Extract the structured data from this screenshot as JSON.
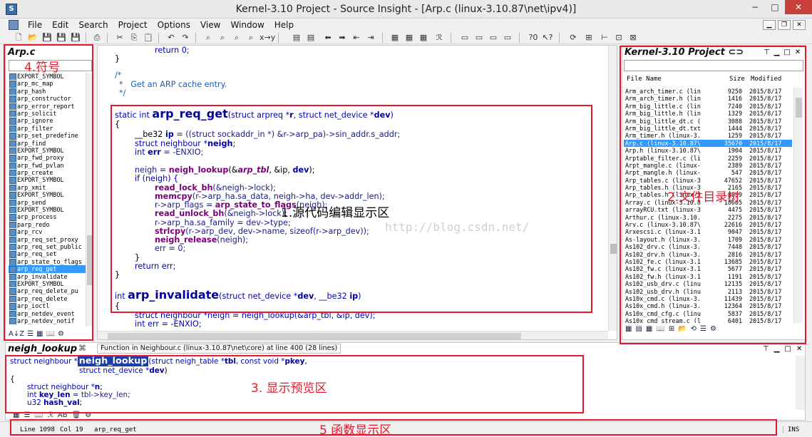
{
  "window": {
    "title": "Kernel-3.10 Project - Source Insight - [Arp.c (linux-3.10.87\\net\\ipv4)]",
    "min": "−",
    "max": "□",
    "close": "✕"
  },
  "menu": [
    "File",
    "Edit",
    "Search",
    "Project",
    "Options",
    "View",
    "Window",
    "Help"
  ],
  "symbols_panel": {
    "title": "Arp.c",
    "label": "4.符号",
    "items": [
      "EXPORT_SYMBOL",
      "arp_mc_map",
      "arp_hash",
      "arp_constructor",
      "arp_error_report",
      "arp_solicit",
      "arp_ignore",
      "arp_filter",
      "arp_set_predefine",
      "arp_find",
      "EXPORT_SYMBOL",
      "arp_fwd_proxy",
      "arp_fwd_pvlan",
      "arp_create",
      "EXPORT_SYMBOL",
      "arp_xmit",
      "EXPORT_SYMBOL",
      "arp_send",
      "EXPORT_SYMBOL",
      "arp_process",
      "parp_redo",
      "arp_rcv",
      "arp_req_set_proxy",
      "arp_req_set_public",
      "arp_req_set",
      "arp_state_to_flags",
      "arp_req_get",
      "arp_invalidate",
      "EXPORT_SYMBOL",
      "arp_req_delete_pu",
      "arp_req_delete",
      "arp_ioctl",
      "arp_netdev_event",
      "arp_netdev_notif"
    ],
    "selected_index": 26
  },
  "editor": {
    "label": "1.源代码编辑显示区",
    "watermark": "http://blog.csdn.net/",
    "lines": {
      "l1": "return 0;",
      "l2": "}",
      "l3": "/*",
      "l4": "*   Get an ARP cache entry.",
      "l5": "*/",
      "sig_kw1": "static int ",
      "sig_name": "arp_req_get",
      "sig_rest1": "(struct arpreq *",
      "sig_r": "r",
      "sig_rest2": ", struct net_device *",
      "sig_dev": "dev",
      "sig_rest3": ")",
      "b_open": "{",
      "be32": "__be32 ",
      "ip": "ip",
      "be32_rest": " = ((struct sockaddr_in *) &r->arp_pa)->sin_addr.s_addr;",
      "neigh_decl": "struct neighbour *",
      "neigh_var": "neigh",
      "err_decl": "int ",
      "err_var": "err",
      "err_rest": " = -ENXIO;",
      "neigh_assign": "neigh = ",
      "neigh_lookup": "neigh_lookup",
      "nl_args1": "(&",
      "arp_tbl": "arp_tbl",
      "nl_args2": ", &ip, ",
      "nl_dev": "dev",
      "nl_args3": ");",
      "if_line": "if (neigh) {",
      "read_lock": "read_lock_bh",
      "read_lock_args": "(&neigh->lock);",
      "memcpy": "memcpy",
      "memcpy_args": "(r->arp_ha.sa_data, neigh->ha, dev->addr_len);",
      "flags_l": "r->arp_flags = ",
      "flags_fn": "arp_state_to_flags",
      "flags_args": "(neigh);",
      "read_unlock": "read_unlock_bh",
      "read_unlock_args": "(&neigh->lock);",
      "family": "r->arp_ha.sa_family = dev->type;",
      "strlcpy": "strlcpy",
      "strlcpy_args": "(r->arp_dev, dev->name, sizeof(r->arp_dev));",
      "release": "neigh_release",
      "release_args": "(neigh);",
      "err0": "err = 0;",
      "close_in": "}",
      "ret_err": "return err;",
      "close_out": "}",
      "inv_kw": "int ",
      "inv_name": "arp_invalidate",
      "inv_args1": "(struct net_device *",
      "inv_dev": "dev",
      "inv_args2": ", __be32 ",
      "inv_ip": "ip",
      "inv_args3": ")",
      "inv_open": "{",
      "inv_neigh": "struct neighbour *neigh = neigh_lookup(&arp_tbl, &ip, dev);",
      "inv_err": "int err = -ENXIO;"
    }
  },
  "project_panel": {
    "title": "Kernel-3.10 Project",
    "label": "2.文件目录树",
    "col_name": "File Name",
    "col_size": "Size",
    "col_mod": "Modified",
    "files": [
      [
        "Arm_arch_timer.c (lin",
        "9250",
        "2015/8/17"
      ],
      [
        "Arm_arch_timer.h (lin",
        "1416",
        "2015/8/17"
      ],
      [
        "Arm_big_little.c (lin",
        "7240",
        "2015/8/17"
      ],
      [
        "Arm_big_little.h (lin",
        "1329",
        "2015/8/17"
      ],
      [
        "Arm_big_little_dt.c (",
        "3088",
        "2015/8/17"
      ],
      [
        "Arm_big_little_dt.txt",
        "1444",
        "2015/8/17"
      ],
      [
        "Arm_timer.h (linux-3.",
        "1259",
        "2015/8/17"
      ],
      [
        "Arp.c (linux-3.10.87\\",
        "35670",
        "2015/8/17"
      ],
      [
        "Arp.h (linux-3.10.87\\",
        "1904",
        "2015/8/17"
      ],
      [
        "Arptable_filter.c (li",
        "2259",
        "2015/8/17"
      ],
      [
        "Arpt_mangle.c (linux-",
        "2389",
        "2015/8/17"
      ],
      [
        "Arpt_mangle.h (linux-",
        "547",
        "2015/8/17"
      ],
      [
        "Arp_tables.c (linux-3",
        "47652",
        "2015/8/17"
      ],
      [
        "Arp_tables.h (linux-3",
        "2165",
        "2015/8/17"
      ],
      [
        "Arp_tables.h (linux-3",
        "8899",
        "2015/8/17"
      ],
      [
        "Array.c (linux-3.10.8",
        "18605",
        "2015/8/17"
      ],
      [
        "arrayRCU.txt (linux-3",
        "4475",
        "2015/8/17"
      ],
      [
        "Arthur.c (linux-3.10.",
        "2275",
        "2015/8/17"
      ],
      [
        "Arv.c (linux-3.10.87\\",
        "22616",
        "2015/8/17"
      ],
      [
        "Arxescsi.c (linux-3.1",
        "9047",
        "2015/8/17"
      ],
      [
        "As-layout.h (linux-3.",
        "1709",
        "2015/8/17"
      ],
      [
        "As102_drv.c (linux-3.",
        "7448",
        "2015/8/17"
      ],
      [
        "As102_drv.h (linux-3.",
        "2816",
        "2015/8/17"
      ],
      [
        "As102_fe.c (linux-3.1",
        "13685",
        "2015/8/17"
      ],
      [
        "As102_fw.c (linux-3.1",
        "5677",
        "2015/8/17"
      ],
      [
        "As102_fw.h (linux-3.1",
        "1191",
        "2015/8/17"
      ],
      [
        "As102_usb_drv.c (linu",
        "12135",
        "2015/8/17"
      ],
      [
        "As102_usb_drv.h (linu",
        "2113",
        "2015/8/17"
      ],
      [
        "As10x_cmd.c (linux-3.",
        "11439",
        "2015/8/17"
      ],
      [
        "As10x_cmd.h (linux-3.",
        "12364",
        "2015/8/17"
      ],
      [
        "As10x_cmd_cfg.c (linu",
        "5837",
        "2015/8/17"
      ],
      [
        "As10x_cmd_stream.c (l",
        "6401",
        "2015/8/17"
      ]
    ],
    "selected_index": 7
  },
  "preview": {
    "title": "neigh_lookup",
    "info": "Function in Neighbour.c (linux-3.10.87\\net\\core) at line 400 (28 lines)",
    "label": "3. 显示预览区",
    "p1a": "struct neighbour *",
    "p1_hl": "neigh_lookup",
    "p1b": "(struct neigh_table *",
    "p1_tbl": "tbl",
    "p1c": ", const void *",
    "p1_pkey": "pkey",
    "p1d": ",",
    "p2a": "struct net_device *",
    "p2_dev": "dev",
    "p2b": ")",
    "p3": "{",
    "p4a": "struct neighbour *",
    "p4_n": "n",
    "p4b": ";",
    "p5a": "int ",
    "p5_key": "key_len",
    "p5b": " = tbl->key_len;",
    "p6a": "u32 ",
    "p6_hash": "hash_val",
    "p6b": ";"
  },
  "status": {
    "line": "Line 1098",
    "col": "Col 19",
    "symbol": "arp_req_get",
    "mode": "INS",
    "label": "5 函数显示区"
  }
}
